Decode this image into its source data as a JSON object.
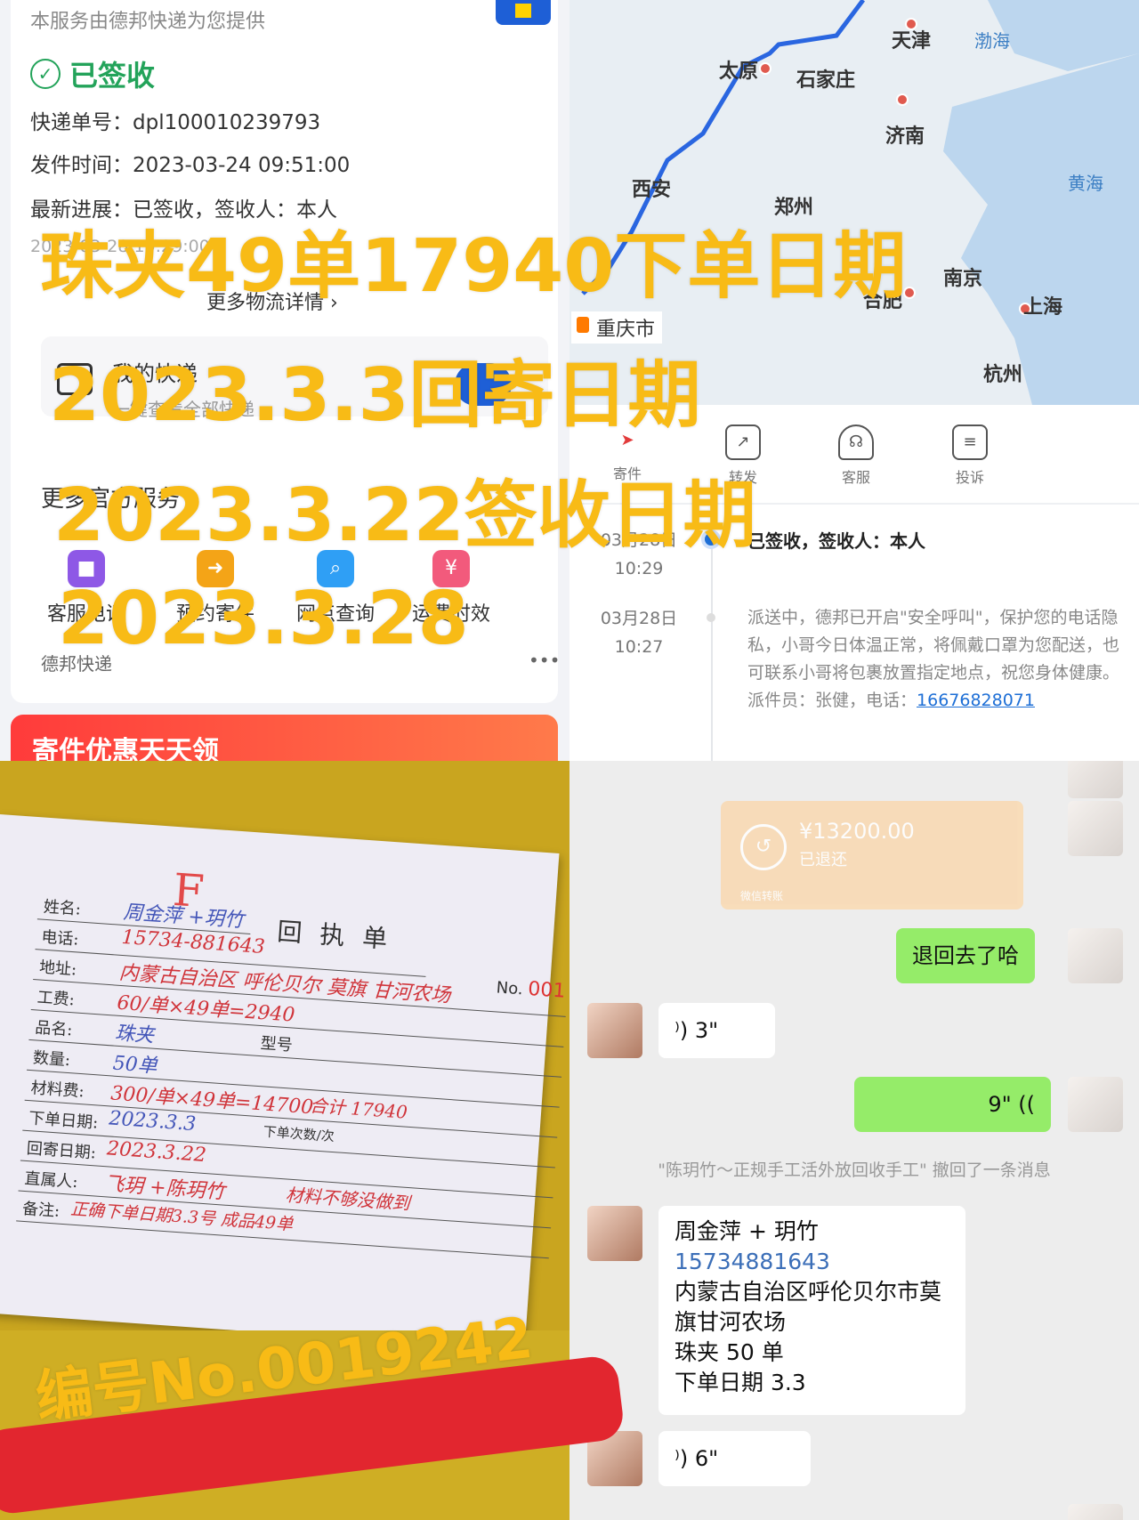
{
  "tracking": {
    "provider_text": "本服务由德邦快递为您提供",
    "status": "已签收",
    "waybill_label": "快递单号：",
    "waybill_value": "dpl100010239793",
    "send_time_label": "发件时间：",
    "send_time_value": "2023-03-24 09:51:00",
    "latest_label": "最新进展：",
    "latest_value": "已签收，签收人：本人",
    "latest_time": "2023-03-28 10:29:00",
    "more_logistics": "更多物流详情 ›",
    "my_express": {
      "title": "我的快递",
      "subtitle": "一键查看全部快递"
    },
    "more_services_title": "更多官方服务 ›",
    "services": [
      {
        "label": "客服电话",
        "icon": "bus-icon",
        "color": "#8e58e6"
      },
      {
        "label": "预约寄件",
        "icon": "arrow-right-icon",
        "color": "#f4a417"
      },
      {
        "label": "网点查询",
        "icon": "search-icon",
        "color": "#2f9ff5"
      },
      {
        "label": "运费时效",
        "icon": "yen-icon",
        "color": "#f25a7c"
      }
    ],
    "footer_text": "德邦快递",
    "footer_more": "•••",
    "promo_text": "寄件优惠天天领"
  },
  "map": {
    "cities": [
      {
        "name": "天津"
      },
      {
        "name": "太原"
      },
      {
        "name": "石家庄"
      },
      {
        "name": "济南"
      },
      {
        "name": "西安"
      },
      {
        "name": "郑州"
      },
      {
        "name": "合肥"
      },
      {
        "name": "南京"
      },
      {
        "name": "上海"
      },
      {
        "name": "杭州"
      }
    ],
    "seas": [
      "渤海",
      "黄海"
    ],
    "current_city": "重庆市"
  },
  "actions": [
    {
      "label": "寄件",
      "icon": "send-icon"
    },
    {
      "label": "转发",
      "icon": "share-icon"
    },
    {
      "label": "客服",
      "icon": "headset-icon"
    },
    {
      "label": "投诉",
      "icon": "complaint-icon"
    }
  ],
  "timeline": [
    {
      "date": "03月28日",
      "time": "10:29",
      "text": "已签收，签收人：本人"
    },
    {
      "date": "03月28日",
      "time": "10:27",
      "text": "派送中，德邦已开启\"安全呼叫\"，保护您的电话隐私，小哥今日体温正常，将佩戴口罩为您配送，也可联系小哥将包裹放置指定地点，祝您身体健康。派件员：张健，电话：",
      "link": "16676828071"
    }
  ],
  "receipt": {
    "mark": "F",
    "title": "回执单",
    "no_label": "No.",
    "no_value": "001",
    "rows": [
      {
        "label": "姓名:",
        "value": "周金萍 +玥竹"
      },
      {
        "label": "电话:",
        "value": "15734-881643"
      },
      {
        "label": "地址:",
        "value": "内蒙古自治区 呼伦贝尔 莫旗 甘河农场"
      },
      {
        "label": "工费:",
        "value": "60/单×49单=2940"
      },
      {
        "label": "品名:",
        "value": "珠夹"
      },
      {
        "label": "数量:",
        "value": "50单"
      },
      {
        "label": "材料费:",
        "value": "300/单×49单=14700"
      },
      {
        "label": "下单日期:",
        "value": "2023.3.3"
      },
      {
        "label": "回寄日期:",
        "value": "2023.3.22"
      },
      {
        "label": "直属人:",
        "value": "飞玥 +陈玥竹"
      },
      {
        "label": "备注:",
        "value": "正确下单日期3.3号 成品49单"
      }
    ],
    "model_label": "型号",
    "order_count_label": "下单次数/次",
    "total_text": "合计 17940",
    "note_text": "材料不够没做到"
  },
  "chat": {
    "transfer_amount": "¥13200.00",
    "transfer_status": "已退还",
    "transfer_footer": "微信转账",
    "msg_returned": "退回去了哈",
    "voice_1": "3\"",
    "voice_2": "9\"",
    "recall_text": "\"陈玥竹～正规手工活外放回收手工\" 撤回了一条消息",
    "card_name": "周金萍 + 玥竹",
    "card_phone": "15734881643",
    "card_address": "内蒙古自治区呼伦贝尔市莫旗甘河农场",
    "card_item": "珠夹 50 单",
    "card_date": "下单日期 3.3",
    "voice_3": "6\""
  },
  "overlay": {
    "line1": "珠夹49单17940下单日期",
    "line2": "2023.3.3回寄日期",
    "line3": "2023.3.22签收日期",
    "line4": "2023.3.28",
    "serial": "编号No.0019242"
  },
  "colors": {
    "overlay_yellow": "#f8bb16",
    "sign_green": "#23a35a",
    "brand_blue": "#1e5fd6",
    "chat_green": "#95ec69"
  }
}
